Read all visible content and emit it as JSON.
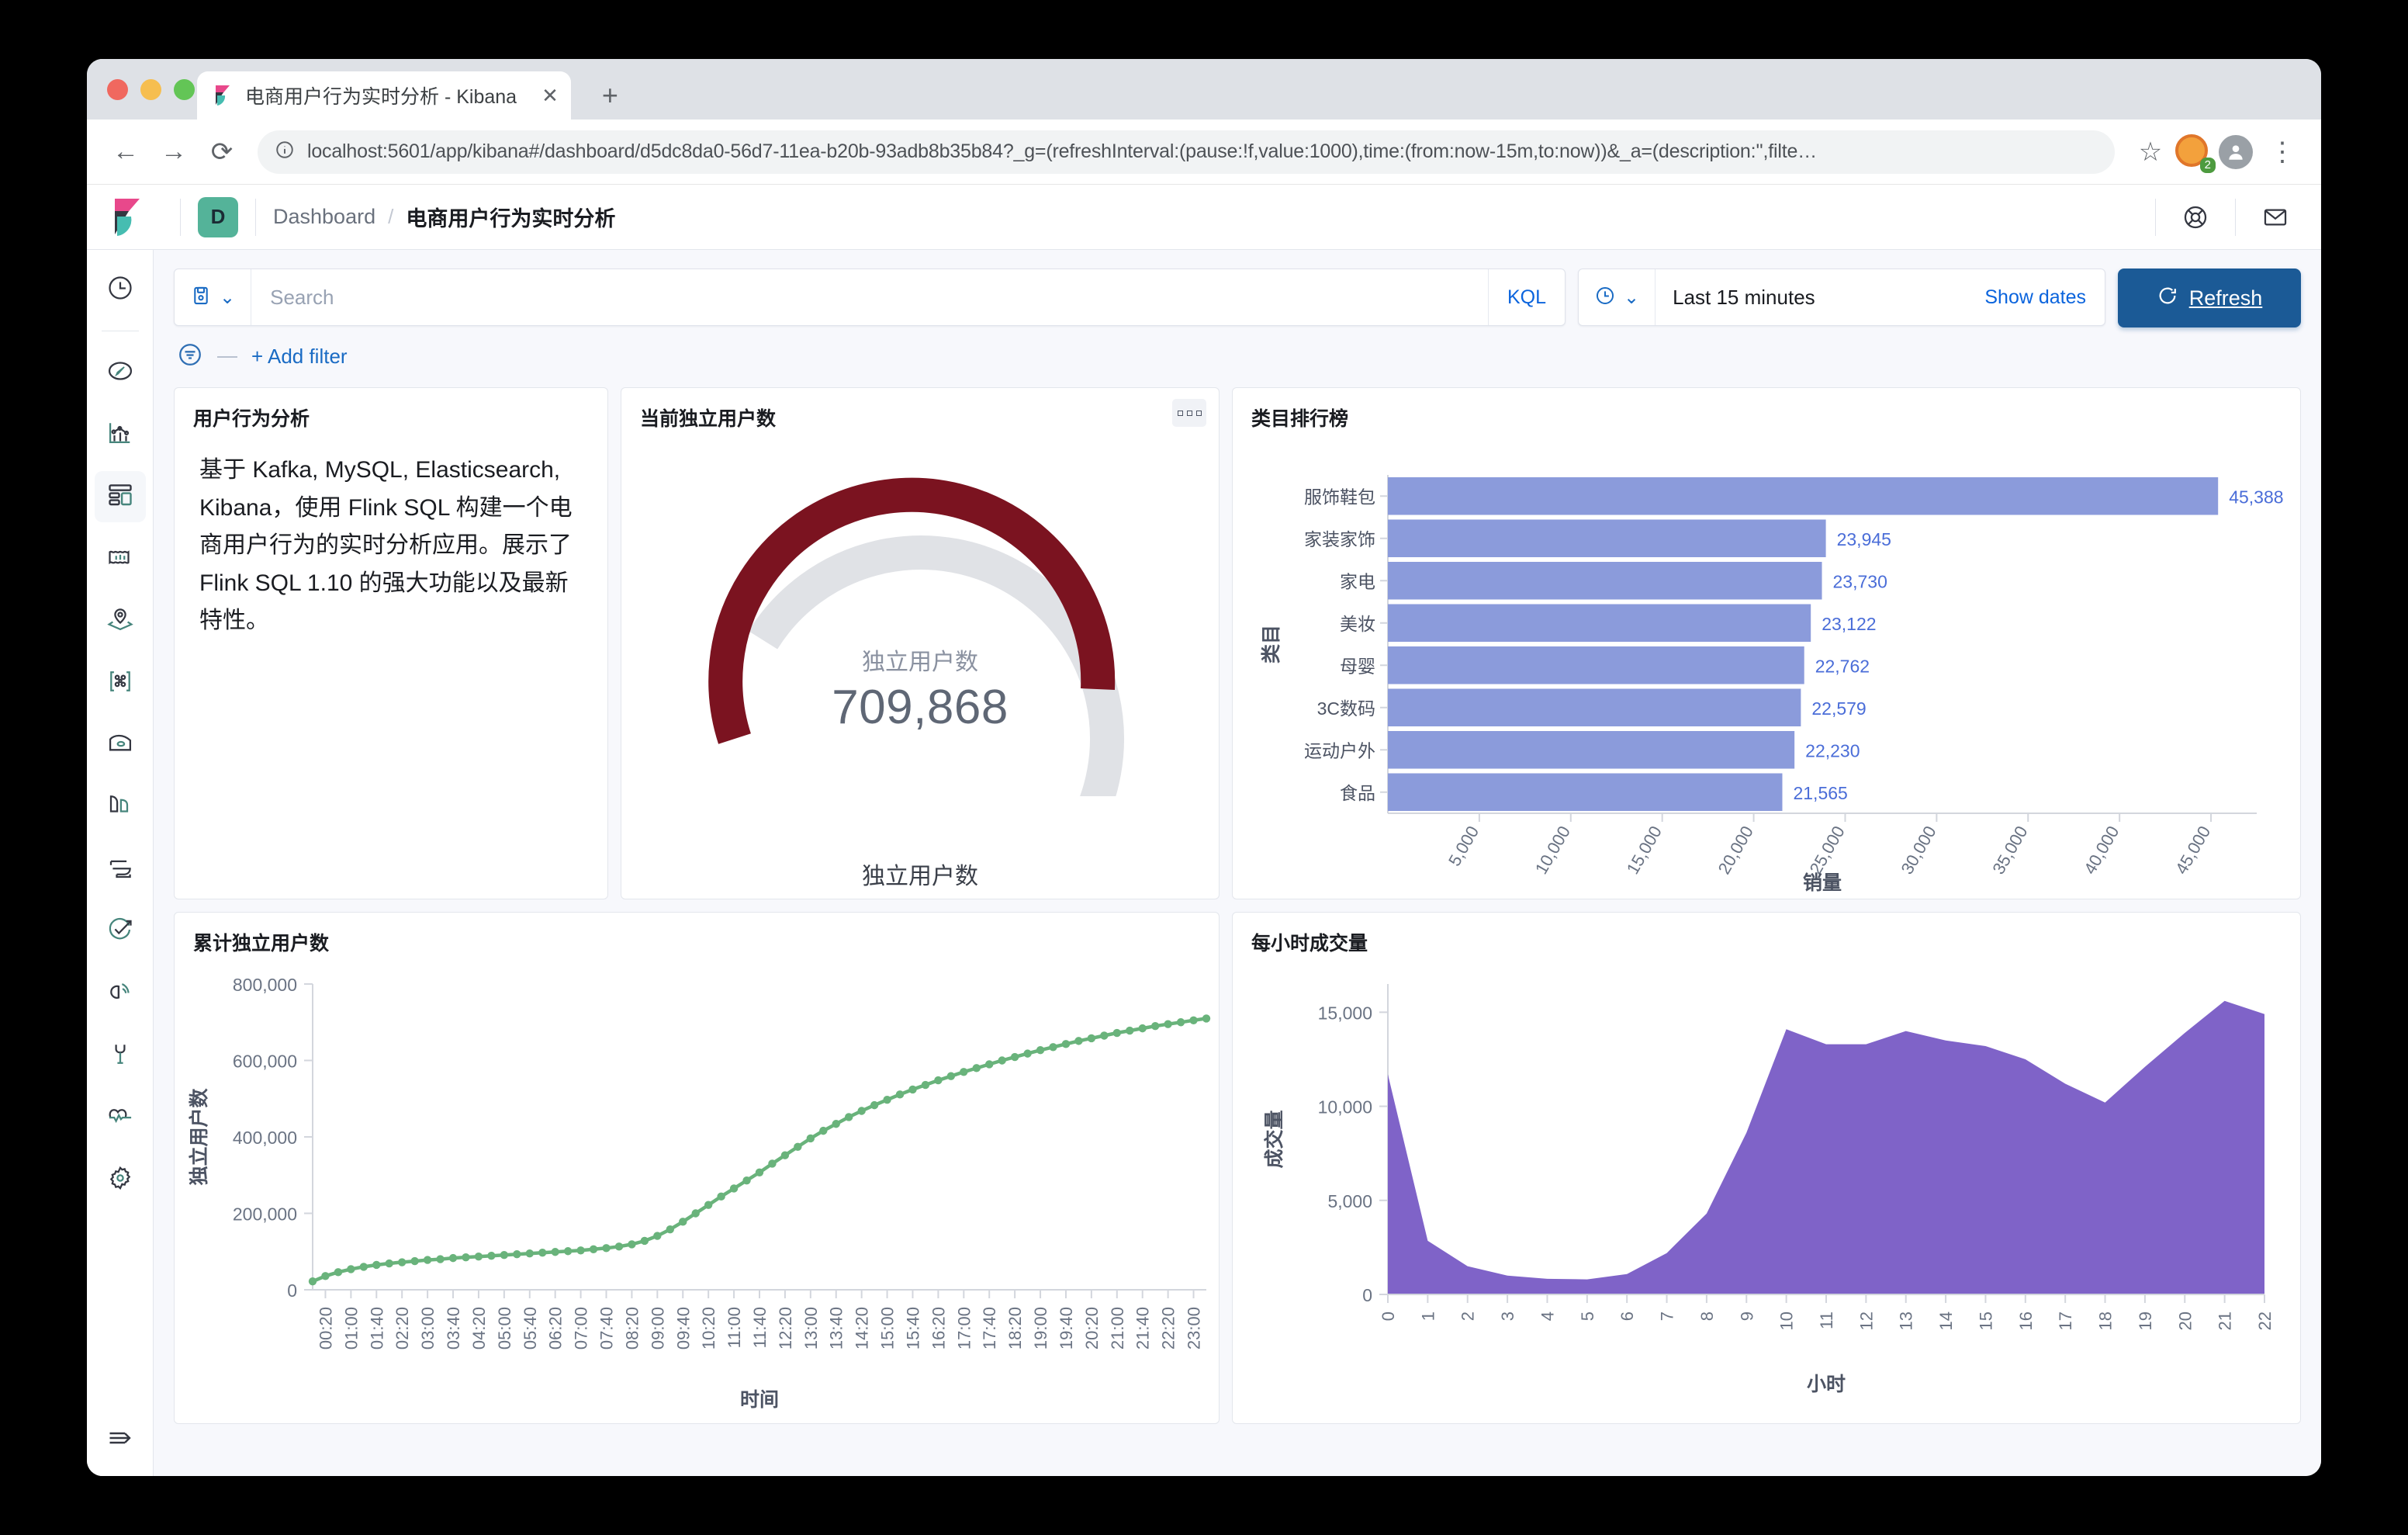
{
  "browser": {
    "tab_title": "电商用户行为实时分析 - Kibana",
    "close_label": "✕",
    "newtab_label": "+",
    "back_label": "←",
    "forward_label": "→",
    "reload_label": "⟳",
    "url": "localhost:5601/app/kibana#/dashboard/d5dc8da0-56d7-11ea-b20b-93adb8b35b84?_g=(refreshInterval:(pause:!f,value:1000),time:(from:now-15m,to:now))&_a=(description:'',filte…",
    "star_label": "☆",
    "extension_count": "2",
    "menu_label": "⋮"
  },
  "header": {
    "space_initial": "D",
    "breadcrumb_root": "Dashboard",
    "breadcrumb_sep": "/",
    "breadcrumb_current": "电商用户行为实时分析",
    "help_icon": "help-life-ring-icon",
    "newsfeed_icon": "newsfeed-envelope-icon"
  },
  "nav": {
    "items": [
      {
        "name": "recently-viewed",
        "icon": "clock-icon"
      },
      {
        "name": "discover",
        "icon": "compass-icon"
      },
      {
        "name": "visualize",
        "icon": "visualize-icon"
      },
      {
        "name": "dashboard",
        "icon": "dashboard-icon",
        "selected": true
      },
      {
        "name": "canvas",
        "icon": "canvas-icon"
      },
      {
        "name": "maps",
        "icon": "maps-pin-icon"
      },
      {
        "name": "graph",
        "icon": "graph-nodes-icon"
      },
      {
        "name": "machine-learning",
        "icon": "ml-icon"
      },
      {
        "name": "infrastructure",
        "icon": "infrastructure-icon"
      },
      {
        "name": "logs",
        "icon": "logs-icon"
      },
      {
        "name": "uptime",
        "icon": "uptime-icon"
      },
      {
        "name": "apm",
        "icon": "apm-icon"
      },
      {
        "name": "dev-tools",
        "icon": "wrench-icon"
      },
      {
        "name": "monitoring",
        "icon": "heart-pulse-icon"
      },
      {
        "name": "management",
        "icon": "gear-icon"
      }
    ],
    "collapse_icon": "collapse-arrow-icon"
  },
  "query": {
    "saved_query_icon": "save-icon",
    "chevron": "⌄",
    "search_placeholder": "Search",
    "kql_label": "KQL",
    "date_icon": "clock-icon",
    "date_value": "Last 15 minutes",
    "show_dates_label": "Show dates",
    "refresh_label": "Refresh",
    "refresh_icon": "refresh-icon",
    "filter_icon": "filter-icon",
    "add_filter_label": "+ Add filter"
  },
  "panels": {
    "markdown": {
      "title": "用户行为分析",
      "body": "基于 Kafka, MySQL, Elasticsearch, Kibana，使用 Flink SQL 构建一个电商用户行为的实时分析应用。展示了 Flink SQL 1.10 的强大功能以及最新特性。"
    },
    "gauge": {
      "title": "当前独立用户数",
      "metric_label": "独立用户数",
      "metric_value": "709,868",
      "footer_label": "独立用户数",
      "menu_icon": "panel-context-menu-icon"
    },
    "bar": {
      "title": "类目排行榜"
    },
    "line": {
      "title": "累计独立用户数"
    },
    "area": {
      "title": "每小时成交量"
    }
  },
  "colors": {
    "gauge_arc": "#7b1320",
    "gauge_rest": "#e0e2e6",
    "bar_fill": "#8b9bdb",
    "bar_label": "#4a6dd8",
    "line_stroke": "#69b37b",
    "area_fill": "#7f63c8",
    "refresh_bg": "#1b5a96",
    "accent_link": "#0b64dd",
    "space_badge": "#54b399"
  },
  "chart_data": [
    {
      "type": "bar",
      "orientation": "horizontal",
      "title": "类目排行榜",
      "xlabel": "销量",
      "ylabel": "类目",
      "categories": [
        "服饰鞋包",
        "家装家饰",
        "家电",
        "美妆",
        "母婴",
        "3C数码",
        "运动户外",
        "食品"
      ],
      "values": [
        45388,
        23945,
        23730,
        23122,
        22762,
        22579,
        22230,
        21565
      ],
      "value_labels": [
        "45,388",
        "23,945",
        "23,730",
        "23,122",
        "22,762",
        "22,579",
        "22,230",
        "21,565"
      ],
      "xticks": [
        5000,
        10000,
        15000,
        20000,
        25000,
        30000,
        35000,
        40000,
        45000
      ],
      "xtick_labels": [
        "5,000",
        "10,000",
        "15,000",
        "20,000",
        "25,000",
        "30,000",
        "35,000",
        "40,000",
        "45,000"
      ],
      "xlim": [
        0,
        47500
      ],
      "grid": false,
      "legend": "none"
    },
    {
      "type": "line",
      "title": "累计独立用户数",
      "xlabel": "时间",
      "ylabel": "独立用户数",
      "yticks": [
        0,
        200000,
        400000,
        600000,
        800000
      ],
      "ytick_labels": [
        "0",
        "200,000",
        "400,000",
        "600,000",
        "800,000"
      ],
      "ylim": [
        0,
        800000
      ],
      "xtick_labels": [
        "00:20",
        "01:00",
        "01:40",
        "02:20",
        "03:00",
        "03:40",
        "04:20",
        "05:00",
        "05:40",
        "06:20",
        "07:00",
        "07:40",
        "08:20",
        "09:00",
        "09:40",
        "10:20",
        "11:00",
        "11:40",
        "12:20",
        "13:00",
        "13:40",
        "14:20",
        "15:00",
        "15:40",
        "16:20",
        "17:00",
        "17:40",
        "18:20",
        "19:00",
        "19:40",
        "20:20",
        "21:00",
        "21:40",
        "22:20",
        "23:00"
      ],
      "markers": true,
      "grid": false,
      "x": [
        "00:00",
        "00:20",
        "00:40",
        "01:00",
        "01:20",
        "01:40",
        "02:00",
        "02:20",
        "02:40",
        "03:00",
        "03:20",
        "03:40",
        "04:00",
        "04:20",
        "04:40",
        "05:00",
        "05:20",
        "05:40",
        "06:00",
        "06:20",
        "06:40",
        "07:00",
        "07:20",
        "07:40",
        "08:00",
        "08:20",
        "08:40",
        "09:00",
        "09:20",
        "09:40",
        "10:00",
        "10:20",
        "10:40",
        "11:00",
        "11:20",
        "11:40",
        "12:00",
        "12:20",
        "12:40",
        "13:00",
        "13:20",
        "13:40",
        "14:00",
        "14:20",
        "14:40",
        "15:00",
        "15:20",
        "15:40",
        "16:00",
        "16:20",
        "16:40",
        "17:00",
        "17:20",
        "17:40",
        "18:00",
        "18:20",
        "18:40",
        "19:00",
        "19:20",
        "19:40",
        "20:00",
        "20:20",
        "20:40",
        "21:00",
        "21:20",
        "21:40",
        "22:00",
        "22:20",
        "22:40",
        "23:00",
        "23:20"
      ],
      "values": [
        22000,
        36000,
        46000,
        54000,
        60000,
        65000,
        69000,
        72000,
        75000,
        78000,
        80000,
        83000,
        85000,
        87000,
        89000,
        91000,
        93000,
        95000,
        97000,
        99000,
        101000,
        103000,
        106000,
        109000,
        113000,
        119000,
        128000,
        141000,
        158000,
        178000,
        200000,
        222000,
        244000,
        265000,
        286000,
        307000,
        330000,
        352000,
        374000,
        396000,
        416000,
        434000,
        452000,
        468000,
        483000,
        497000,
        511000,
        524000,
        536000,
        548000,
        559000,
        570000,
        580000,
        590000,
        600000,
        609000,
        618000,
        627000,
        635000,
        643000,
        651000,
        658000,
        665000,
        672000,
        678000,
        684000,
        690000,
        695000,
        700000,
        705000,
        709868
      ]
    },
    {
      "type": "area",
      "title": "每小时成交量",
      "xlabel": "小时",
      "ylabel": "成交量",
      "yticks": [
        0,
        5000,
        10000,
        15000
      ],
      "ytick_labels": [
        "0",
        "5,000",
        "10,000",
        "15,000"
      ],
      "ylim": [
        0,
        16500
      ],
      "x": [
        0,
        1,
        2,
        3,
        4,
        5,
        6,
        7,
        8,
        9,
        10,
        11,
        12,
        13,
        14,
        15,
        16,
        17,
        18,
        19,
        20,
        21,
        22
      ],
      "xtick_labels": [
        "0",
        "1",
        "2",
        "3",
        "4",
        "5",
        "6",
        "7",
        "8",
        "9",
        "10",
        "11",
        "12",
        "13",
        "14",
        "15",
        "16",
        "17",
        "18",
        "19",
        "20",
        "21",
        "22"
      ],
      "values": [
        11700,
        2850,
        1500,
        1000,
        830,
        800,
        1080,
        2200,
        4300,
        8600,
        14100,
        13300,
        13300,
        14000,
        13500,
        13200,
        12500,
        11200,
        10200,
        12100,
        13900,
        15600,
        14900
      ],
      "grid": false,
      "legend": "none"
    }
  ]
}
